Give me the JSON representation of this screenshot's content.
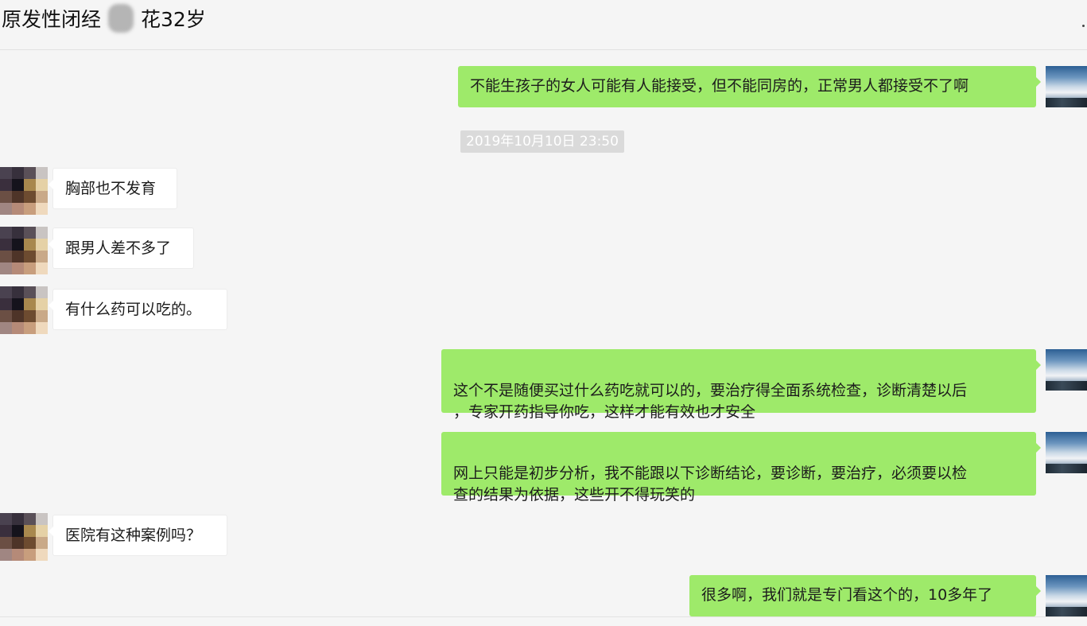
{
  "header": {
    "title": "原发性闭经　　花32岁"
  },
  "messages": [
    {
      "side": "sent",
      "text": "不能生孩子的女人可能有人能接受，但不能同房的，正常男人都接受不了啊"
    },
    {
      "side": "recv",
      "text": "胸部也不发育"
    },
    {
      "side": "recv",
      "text": "跟男人差不多了"
    },
    {
      "side": "recv",
      "text": "有什么药可以吃的。"
    },
    {
      "side": "sent",
      "text": "这个不是随便买过什么药吃就可以的，要治疗得全面系统检查，诊断清楚以后\n，专家开药指导你吃，这样才能有效也才安全"
    },
    {
      "side": "sent",
      "text": "网上只能是初步分析，我不能跟以下诊断结论，要诊断，要治疗，必须要以检\n查的结果为依据，这些开不得玩笑的"
    },
    {
      "side": "recv",
      "text": "医院有这种案例吗？"
    },
    {
      "side": "sent",
      "text": "很多啊，我们就是专门看这个的，10多年了"
    }
  ],
  "timestamp": "2019年10月10日 23:50",
  "colors": {
    "sent_bubble": "#9eea6a",
    "recv_bubble": "#ffffff",
    "background": "#f5f5f5"
  },
  "icons": {
    "sent_avatar": "sky-landscape-avatar",
    "recv_avatar": "pixelated-avatar",
    "more": "more-dots-icon"
  }
}
